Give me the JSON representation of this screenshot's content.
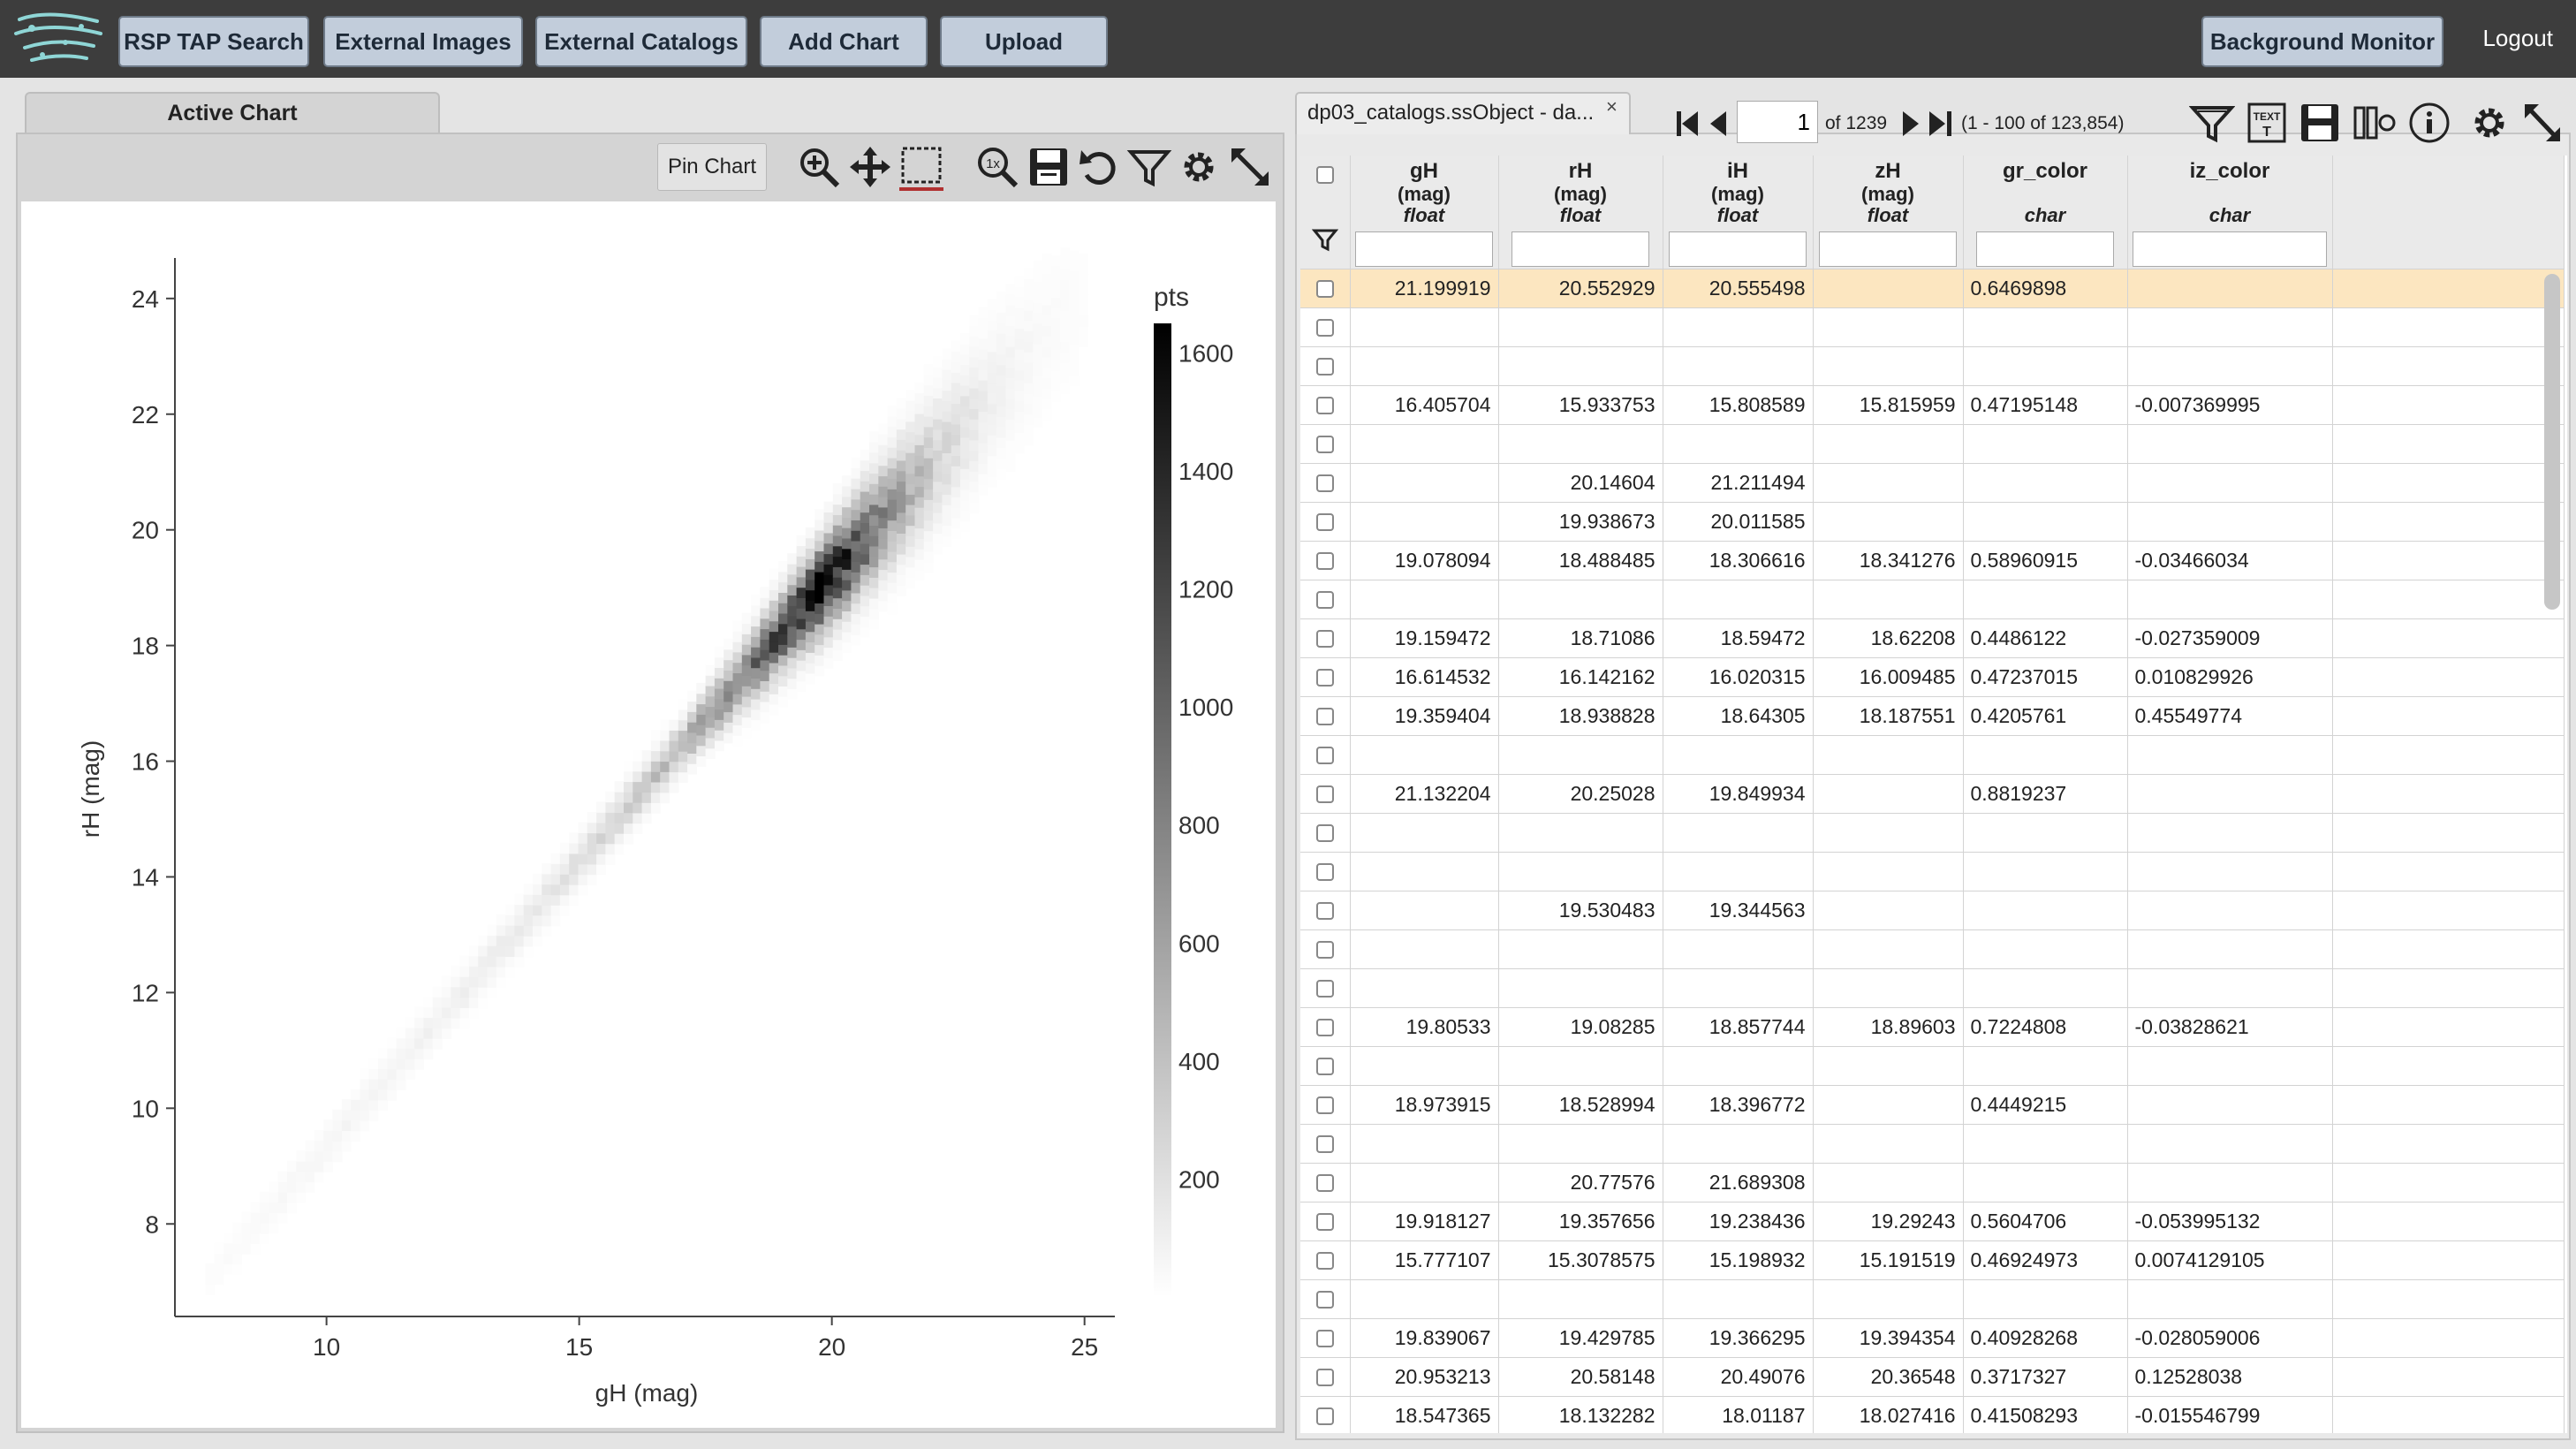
{
  "topbar": {
    "buttons": [
      "RSP TAP Search",
      "External Images",
      "External Catalogs",
      "Add Chart",
      "Upload"
    ],
    "background_monitor": "Background Monitor",
    "logout": "Logout"
  },
  "chart_panel": {
    "tab_label": "Active Chart",
    "pin_chart_label": "Pin Chart",
    "toolbar_icons": [
      "zoom-in-icon",
      "pan-icon",
      "select-box-icon",
      "zoom-reset-icon",
      "save-icon",
      "restore-icon",
      "filter-icon",
      "settings-icon",
      "expand-icon"
    ]
  },
  "chart_data": {
    "type": "heatmap",
    "xlabel": "gH (mag)",
    "ylabel": "rH (mag)",
    "xlim": [
      7.0,
      25.6
    ],
    "ylim": [
      6.4,
      24.7
    ],
    "x_ticks": [
      10,
      15,
      20,
      25
    ],
    "y_ticks": [
      8,
      10,
      12,
      14,
      16,
      18,
      20,
      22,
      24
    ],
    "colorbar": {
      "title": "pts",
      "ticks": [
        1600,
        1400,
        1200,
        1000,
        800,
        600,
        400,
        200
      ],
      "range": [
        0,
        1650
      ],
      "colors": [
        "#ffffff",
        "#000000"
      ]
    },
    "density_profile": [
      {
        "g": 7.6,
        "count": 20
      },
      {
        "g": 9.0,
        "count": 40
      },
      {
        "g": 10.0,
        "count": 70
      },
      {
        "g": 11.0,
        "count": 60
      },
      {
        "g": 12.0,
        "count": 90
      },
      {
        "g": 13.0,
        "count": 110
      },
      {
        "g": 14.0,
        "count": 150
      },
      {
        "g": 15.0,
        "count": 220
      },
      {
        "g": 16.0,
        "count": 330
      },
      {
        "g": 17.0,
        "count": 500
      },
      {
        "g": 18.0,
        "count": 780
      },
      {
        "g": 19.0,
        "count": 1200
      },
      {
        "g": 19.6,
        "count": 1600
      },
      {
        "g": 20.2,
        "count": 1300
      },
      {
        "g": 21.0,
        "count": 700
      },
      {
        "g": 22.0,
        "count": 280
      },
      {
        "g": 23.0,
        "count": 100
      },
      {
        "g": 24.0,
        "count": 40
      },
      {
        "g": 25.0,
        "count": 15
      }
    ],
    "relation": {
      "slope": 0.985,
      "offset": -0.5
    }
  },
  "table_panel": {
    "tab_label": "dp03_catalogs.ssObject - da...",
    "close_symbol": "×",
    "page_input": "1",
    "page_of": "of 1239",
    "page_range": "(1 - 100 of 123,854)",
    "toolbar_icons": [
      "filter-icon",
      "text-view-icon",
      "save-icon",
      "column-options-icon",
      "info-icon",
      "settings-icon",
      "expand-icon"
    ],
    "columns": [
      {
        "name": "gH",
        "unit": "(mag)",
        "type": "float"
      },
      {
        "name": "rH",
        "unit": "(mag)",
        "type": "float"
      },
      {
        "name": "iH",
        "unit": "(mag)",
        "type": "float"
      },
      {
        "name": "zH",
        "unit": "(mag)",
        "type": "float"
      },
      {
        "name": "gr_color",
        "unit": "",
        "type": "char"
      },
      {
        "name": "iz_color",
        "unit": "",
        "type": "char"
      }
    ],
    "rows": [
      [
        "21.199919",
        "20.552929",
        "20.555498",
        "",
        "0.6469898",
        ""
      ],
      [
        "",
        "",
        "",
        "",
        "",
        ""
      ],
      [
        "",
        "",
        "",
        "",
        "",
        ""
      ],
      [
        "16.405704",
        "15.933753",
        "15.808589",
        "15.815959",
        "0.47195148",
        "-0.007369995"
      ],
      [
        "",
        "",
        "",
        "",
        "",
        ""
      ],
      [
        "",
        "20.14604",
        "21.211494",
        "",
        "",
        ""
      ],
      [
        "",
        "19.938673",
        "20.011585",
        "",
        "",
        ""
      ],
      [
        "19.078094",
        "18.488485",
        "18.306616",
        "18.341276",
        "0.58960915",
        "-0.03466034"
      ],
      [
        "",
        "",
        "",
        "",
        "",
        ""
      ],
      [
        "19.159472",
        "18.71086",
        "18.59472",
        "18.62208",
        "0.4486122",
        "-0.027359009"
      ],
      [
        "16.614532",
        "16.142162",
        "16.020315",
        "16.009485",
        "0.47237015",
        "0.010829926"
      ],
      [
        "19.359404",
        "18.938828",
        "18.64305",
        "18.187551",
        "0.4205761",
        "0.45549774"
      ],
      [
        "",
        "",
        "",
        "",
        "",
        ""
      ],
      [
        "21.132204",
        "20.25028",
        "19.849934",
        "",
        "0.8819237",
        ""
      ],
      [
        "",
        "",
        "",
        "",
        "",
        ""
      ],
      [
        "",
        "",
        "",
        "",
        "",
        ""
      ],
      [
        "",
        "19.530483",
        "19.344563",
        "",
        "",
        ""
      ],
      [
        "",
        "",
        "",
        "",
        "",
        ""
      ],
      [
        "",
        "",
        "",
        "",
        "",
        ""
      ],
      [
        "19.80533",
        "19.08285",
        "18.857744",
        "18.89603",
        "0.7224808",
        "-0.03828621"
      ],
      [
        "",
        "",
        "",
        "",
        "",
        ""
      ],
      [
        "18.973915",
        "18.528994",
        "18.396772",
        "",
        "0.4449215",
        ""
      ],
      [
        "",
        "",
        "",
        "",
        "",
        ""
      ],
      [
        "",
        "20.77576",
        "21.689308",
        "",
        "",
        ""
      ],
      [
        "19.918127",
        "19.357656",
        "19.238436",
        "19.29243",
        "0.5604706",
        "-0.053995132"
      ],
      [
        "15.777107",
        "15.3078575",
        "15.198932",
        "15.191519",
        "0.46924973",
        "0.0074129105"
      ],
      [
        "",
        "",
        "",
        "",
        "",
        ""
      ],
      [
        "19.839067",
        "19.429785",
        "19.366295",
        "19.394354",
        "0.40928268",
        "-0.028059006"
      ],
      [
        "20.953213",
        "20.58148",
        "20.49076",
        "20.36548",
        "0.3717327",
        "0.12528038"
      ],
      [
        "18.547365",
        "18.132282",
        "18.01187",
        "18.027416",
        "0.41508293",
        "-0.015546799"
      ]
    ]
  }
}
